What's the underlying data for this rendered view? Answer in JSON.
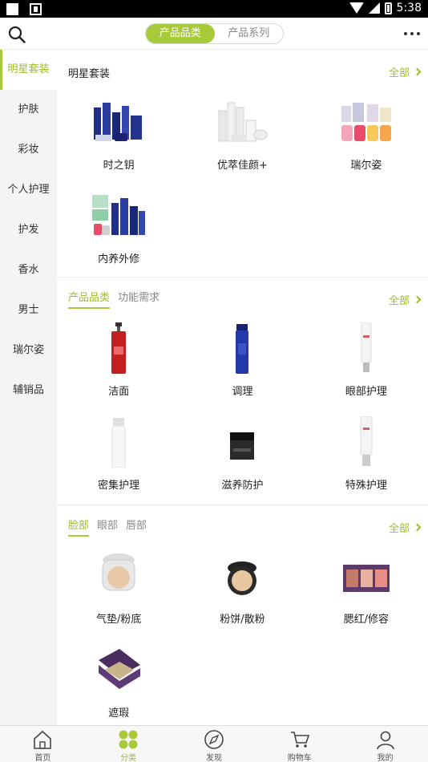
{
  "status": {
    "time": "5:38"
  },
  "header": {
    "tabs": [
      {
        "label": "产品品类",
        "active": true
      },
      {
        "label": "产品系列",
        "active": false
      }
    ]
  },
  "sidebar": {
    "items": [
      {
        "label": "明星套装",
        "active": true
      },
      {
        "label": "护肤"
      },
      {
        "label": "彩妆"
      },
      {
        "label": "个人护理"
      },
      {
        "label": "护发"
      },
      {
        "label": "香水"
      },
      {
        "label": "男士"
      },
      {
        "label": "瑞尔姿"
      },
      {
        "label": "辅销品"
      }
    ]
  },
  "sections": {
    "star": {
      "title": "明星套装",
      "all_label": "全部",
      "items": [
        {
          "label": "时之钥",
          "icon": "blue-bottles-set"
        },
        {
          "label": "优萃佳颜+",
          "icon": "white-bottles-set"
        },
        {
          "label": "瑞尔姿",
          "icon": "supplement-jars"
        },
        {
          "label": "内养外修",
          "icon": "mixed-set"
        }
      ]
    },
    "category": {
      "tabs": [
        "产品品类",
        "功能需求"
      ],
      "all_label": "全部",
      "items": [
        {
          "label": "洁面",
          "icon": "red-pump-bottle"
        },
        {
          "label": "调理",
          "icon": "blue-toner-bottle"
        },
        {
          "label": "眼部护理",
          "icon": "eye-cream-tube"
        },
        {
          "label": "密集护理",
          "icon": "white-bottle"
        },
        {
          "label": "滋养防护",
          "icon": "black-jar"
        },
        {
          "label": "特殊护理",
          "icon": "white-tube"
        }
      ]
    },
    "makeup": {
      "tabs": [
        "脸部",
        "眼部",
        "唇部"
      ],
      "all_label": "全部",
      "items": [
        {
          "label": "气垫/粉底",
          "icon": "cushion-compact"
        },
        {
          "label": "粉饼/散粉",
          "icon": "powder-compact"
        },
        {
          "label": "腮红/修容",
          "icon": "blush-palette"
        },
        {
          "label": "遮瑕",
          "icon": "concealer-palette"
        }
      ]
    }
  },
  "tabbar": {
    "items": [
      {
        "label": "首页",
        "icon": "home-icon"
      },
      {
        "label": "分类",
        "icon": "category-icon",
        "active": true
      },
      {
        "label": "发现",
        "icon": "compass-icon"
      },
      {
        "label": "购物车",
        "icon": "cart-icon"
      },
      {
        "label": "我的",
        "icon": "user-icon"
      }
    ]
  },
  "colors": {
    "accent": "#a8c93a"
  }
}
